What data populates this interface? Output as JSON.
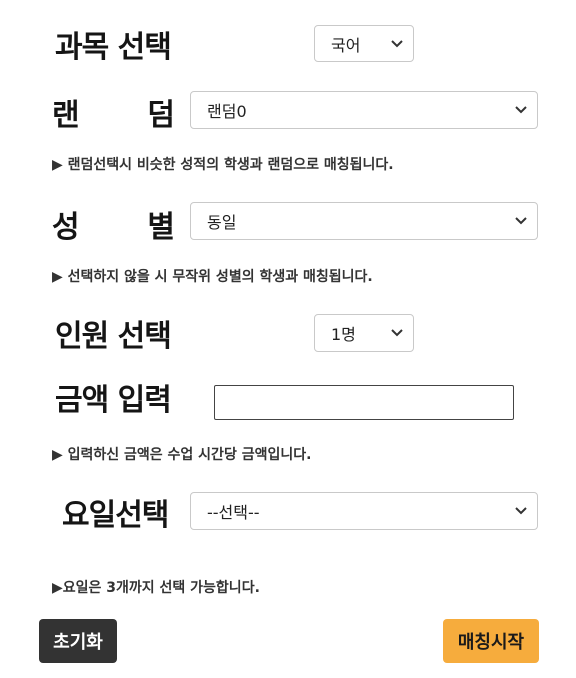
{
  "subject": {
    "label": "과목 선택",
    "selected": "국어"
  },
  "random": {
    "label_chars": [
      "랜",
      "덤"
    ],
    "selected": "랜덤0",
    "note": "▶ 랜덤선택시 비슷한 성적의 학생과 랜덤으로 매칭됩니다."
  },
  "gender": {
    "label_chars": [
      "성",
      "별"
    ],
    "selected": "동일",
    "note": "▶ 선택하지 않을 시 무작위 성별의 학생과 매칭됩니다."
  },
  "headcount": {
    "label": "인원 선택",
    "selected": "1명"
  },
  "amount": {
    "label": "금액 입력",
    "value": "",
    "note": "▶ 입력하신 금액은 수업 시간당 금액입니다."
  },
  "weekday": {
    "label": "요일선택",
    "selected": "--선택--",
    "note": "▶요일은 3개까지 선택 가능합니다."
  },
  "buttons": {
    "reset": "초기화",
    "start": "매칭시작"
  },
  "colors": {
    "reset_bg": "#333333",
    "start_bg": "#f6ac3d"
  },
  "icons": {
    "dropdown": "chevron-down-icon"
  }
}
